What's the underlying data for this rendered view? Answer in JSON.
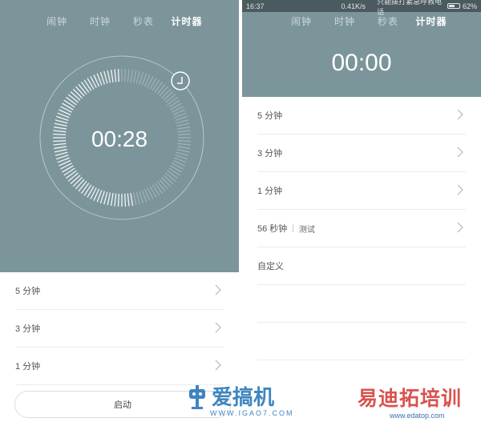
{
  "left": {
    "tabs": [
      {
        "label": "闹钟",
        "active": false
      },
      {
        "label": "时钟",
        "active": false
      },
      {
        "label": "秒表",
        "active": false
      },
      {
        "label": "计时器",
        "active": true
      }
    ],
    "timer": {
      "display": "00:28",
      "progress": 0.47
    },
    "rows": [
      {
        "label": "5 分钟"
      },
      {
        "label": "3 分钟"
      },
      {
        "label": "1 分钟"
      }
    ],
    "start_label": "启动"
  },
  "right": {
    "status": {
      "time": "16:37",
      "net_speed": "0.41K/s",
      "message": "只能拨打紧急呼救电话",
      "battery": "62%"
    },
    "tabs": [
      {
        "label": "闹钟",
        "active": false
      },
      {
        "label": "时钟",
        "active": false
      },
      {
        "label": "秒表",
        "active": false
      },
      {
        "label": "计时器",
        "active": true
      }
    ],
    "timer": {
      "display": "00:00"
    },
    "rows": [
      {
        "label": "5 分钟",
        "note": ""
      },
      {
        "label": "3 分钟",
        "note": ""
      },
      {
        "label": "1 分钟",
        "note": ""
      },
      {
        "label": "56 秒钟",
        "note": "测试"
      },
      {
        "label": "自定义",
        "note": ""
      }
    ]
  },
  "watermarks": {
    "left_brand": "爱搞机",
    "left_url": "WWW.IGAO7.COM",
    "right_brand": "易迪拓培训",
    "right_url": "www.edatop.com"
  },
  "colors": {
    "panel": "#7b959b",
    "statusbar": "#4b5a5e",
    "text": "#555555"
  }
}
